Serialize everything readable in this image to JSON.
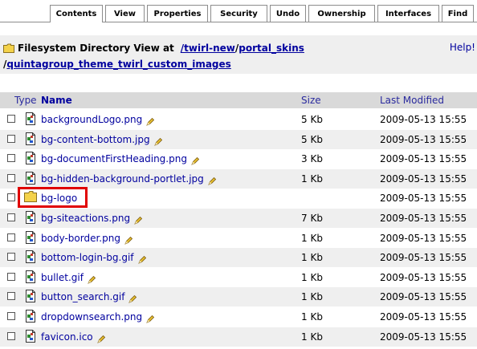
{
  "tabs": [
    "Contents",
    "View",
    "Properties",
    "Security",
    "Undo",
    "Ownership",
    "Interfaces",
    "Find"
  ],
  "header": {
    "prefix": "Filesystem Directory View at",
    "path1": "/twirl-new",
    "path2": "portal_skins",
    "path3_sep": "/",
    "path3": "quintagroup_theme_twirl_custom_images",
    "help": "Help!"
  },
  "table": {
    "col_type": "Type",
    "col_name": "Name",
    "col_size": "Size",
    "col_modified": "Last Modified",
    "rows": [
      {
        "name": "backgroundLogo.png",
        "size": "5 Kb",
        "date": "2009-05-13 15:55",
        "kind": "file"
      },
      {
        "name": "bg-content-bottom.jpg",
        "size": "5 Kb",
        "date": "2009-05-13 15:55",
        "kind": "file"
      },
      {
        "name": "bg-documentFirstHeading.png",
        "size": "3 Kb",
        "date": "2009-05-13 15:55",
        "kind": "file"
      },
      {
        "name": "bg-hidden-background-portlet.jpg",
        "size": "1 Kb",
        "date": "2009-05-13 15:55",
        "kind": "file"
      },
      {
        "name": "bg-logo",
        "size": "",
        "date": "2009-05-13 15:55",
        "kind": "folder"
      },
      {
        "name": "bg-siteactions.png",
        "size": "7 Kb",
        "date": "2009-05-13 15:55",
        "kind": "file"
      },
      {
        "name": "body-border.png",
        "size": "1 Kb",
        "date": "2009-05-13 15:55",
        "kind": "file"
      },
      {
        "name": "bottom-login-bg.gif",
        "size": "1 Kb",
        "date": "2009-05-13 15:55",
        "kind": "file"
      },
      {
        "name": "bullet.gif",
        "size": "1 Kb",
        "date": "2009-05-13 15:55",
        "kind": "file"
      },
      {
        "name": "button_search.gif",
        "size": "1 Kb",
        "date": "2009-05-13 15:55",
        "kind": "file"
      },
      {
        "name": "dropdownsearch.png",
        "size": "1 Kb",
        "date": "2009-05-13 15:55",
        "kind": "file"
      },
      {
        "name": "favicon.ico",
        "size": "1 Kb",
        "date": "2009-05-13 15:55",
        "kind": "file"
      }
    ]
  },
  "colors": {
    "link": "#00009e",
    "row_alt": "#efefef",
    "header_bg": "#d9d9d9",
    "highlight": "#e00000"
  }
}
